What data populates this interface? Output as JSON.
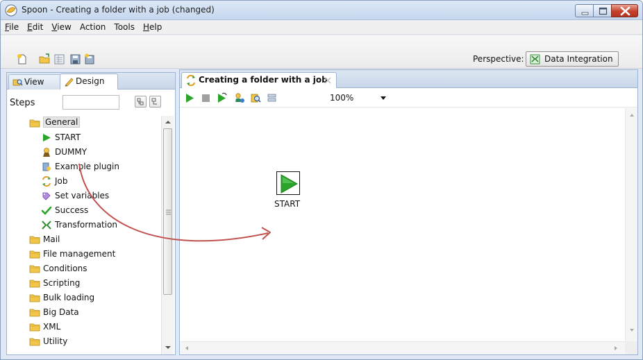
{
  "window": {
    "title": "Spoon - Creating a folder with a job (changed)"
  },
  "menu": [
    {
      "label": "File",
      "mnemonic": "F",
      "rest": "ile"
    },
    {
      "label": "Edit",
      "mnemonic": "E",
      "rest": "dit"
    },
    {
      "label": "View",
      "mnemonic": "V",
      "rest": "iew"
    },
    {
      "label": "Action",
      "mnemonic": "",
      "rest": "Action"
    },
    {
      "label": "Tools",
      "mnemonic": "",
      "rest": "Tools"
    },
    {
      "label": "Help",
      "mnemonic": "H",
      "rest": "elp"
    }
  ],
  "toolbar": {
    "icons": [
      "new-file-icon",
      "open-folder-icon",
      "explore-repository-icon",
      "save-icon",
      "save-as-icon"
    ],
    "perspective_label": "Perspective:",
    "perspective_value": "Data Integration"
  },
  "left_panel": {
    "tabs": {
      "view": "View",
      "design": "Design"
    },
    "steps_label": "Steps",
    "search_value": "",
    "tree": [
      {
        "label": "General",
        "type": "folder",
        "level": 0,
        "selected": true
      },
      {
        "label": "START",
        "type": "start",
        "level": 1
      },
      {
        "label": "DUMMY",
        "type": "dummy",
        "level": 1
      },
      {
        "label": "Example plugin",
        "type": "plugin",
        "level": 1
      },
      {
        "label": "Job",
        "type": "job",
        "level": 1
      },
      {
        "label": "Set variables",
        "type": "setvar",
        "level": 1
      },
      {
        "label": "Success",
        "type": "success",
        "level": 1
      },
      {
        "label": "Transformation",
        "type": "transformation",
        "level": 1
      },
      {
        "label": "Mail",
        "type": "folder",
        "level": 0
      },
      {
        "label": "File management",
        "type": "folder",
        "level": 0
      },
      {
        "label": "Conditions",
        "type": "folder",
        "level": 0
      },
      {
        "label": "Scripting",
        "type": "folder",
        "level": 0
      },
      {
        "label": "Bulk loading",
        "type": "folder",
        "level": 0
      },
      {
        "label": "Big Data",
        "type": "folder",
        "level": 0
      },
      {
        "label": "XML",
        "type": "folder",
        "level": 0
      },
      {
        "label": "Utility",
        "type": "folder",
        "level": 0
      }
    ]
  },
  "job_tab": {
    "label": "Creating a folder with a job",
    "zoom": "100%",
    "entries": [
      {
        "label": "START"
      }
    ]
  },
  "colors": {
    "accent_arrow": "#c0504d",
    "run_green": "#2aa52a",
    "folder_yellow": "#f2c54b"
  }
}
